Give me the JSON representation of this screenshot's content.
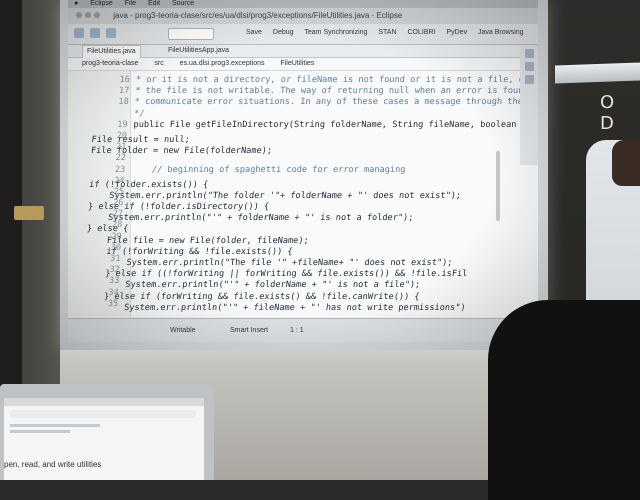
{
  "mac_menu": {
    "app": "Eclipse",
    "file": "File",
    "edit": "Edit",
    "source": "Source"
  },
  "window_title": "java - prog3-teoria-clase/src/es/ua/dlsi/prog3/exceptions/FileUtilities.java - Eclipse",
  "toolbar": {
    "save": "Save",
    "debug": "Debug",
    "team": "Team Synchronizing",
    "stan": "STAN",
    "colibri": "COLIBRI",
    "pydev": "PyDev",
    "java_browsing": "Java Browsing"
  },
  "editor_tabs": [
    "FileUtilities.java",
    "FileUtilitiesApp.java"
  ],
  "breadcrumb": [
    "prog3-teoria-clase",
    "src",
    "es.ua.dlsi.prog3.exceptions",
    "FileUtilities"
  ],
  "code_lines": [
    {
      "num": "16",
      "text": "* or it is not a directory, or fileName is not found or it is not a file, or",
      "style": "comment"
    },
    {
      "num": "17",
      "text": "* the file is not writable. The way of returning null when an error is found",
      "style": "comment"
    },
    {
      "num": "18",
      "text": "* communicate error situations. In any of these cases a message through the s",
      "style": "comment"
    },
    {
      "num": "",
      "text": "*/",
      "style": "comment"
    },
    {
      "num": "19",
      "text": "public File getFileInDirectory(String folderName, String fileName, boolean for",
      "style": "kw"
    },
    {
      "num": "20",
      "text": "    File result = null;",
      "style": "code"
    },
    {
      "num": "21",
      "text": "    File folder = new File(folderName);",
      "style": "code"
    },
    {
      "num": "22",
      "text": "",
      "style": "code"
    },
    {
      "num": "23",
      "text": "    // beginning of spaghetti code for error managing",
      "style": "comment"
    },
    {
      "num": "24",
      "text": "    if (!folder.exists()) {",
      "style": "code"
    },
    {
      "num": "25",
      "text": "        System.err.println(\"The folder '\"+ folderName + \"' does not exist\");",
      "style": "code"
    },
    {
      "num": "26",
      "text": "    } else if (!folder.isDirectory()) {",
      "style": "code"
    },
    {
      "num": "27",
      "text": "        System.err.println(\"'\" + folderName + \"' is not a folder\");",
      "style": "code"
    },
    {
      "num": "28",
      "text": "    } else {",
      "style": "code"
    },
    {
      "num": "29",
      "text": "        File file = new File(folder, fileName);",
      "style": "code"
    },
    {
      "num": "30",
      "text": "        if (!forWriting && !file.exists()) {",
      "style": "code"
    },
    {
      "num": "31",
      "text": "            System.err.println(\"The file '\" +fileName+ \"' does not exist\");",
      "style": "code"
    },
    {
      "num": "32",
      "text": "        } else if ((!forWriting || forWriting && file.exists()) && !file.isFil",
      "style": "code"
    },
    {
      "num": "33",
      "text": "            System.err.println(\"'\" + folderName + \"' is not a file\");",
      "style": "code"
    },
    {
      "num": "34",
      "text": "        } else if (forWriting && file.exists() && !file.canWrite()) {",
      "style": "code"
    },
    {
      "num": "35",
      "text": "            System.err.println(\"'\" + fileName + \"' has not write permissions\")",
      "style": "code"
    }
  ],
  "status_bar": {
    "mode": "Writable",
    "insert": "Smart Insert",
    "position": "1 : 1"
  },
  "whiteboard_text": "O D",
  "laptop_caption": "pen, read, and write utilities"
}
